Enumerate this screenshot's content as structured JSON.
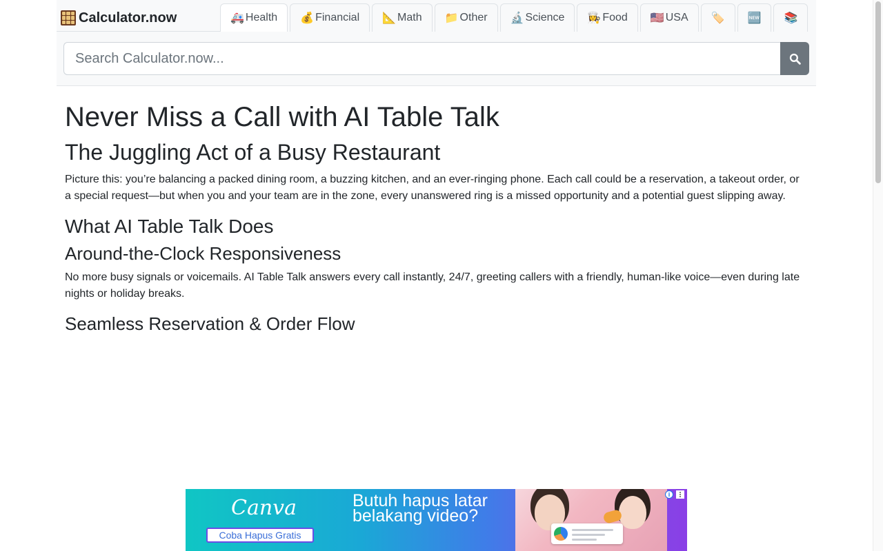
{
  "site": {
    "name": "Calculator.now"
  },
  "tabs": [
    {
      "emoji": "🚑",
      "label": "Health"
    },
    {
      "emoji": "💰",
      "label": "Financial"
    },
    {
      "emoji": "📐",
      "label": "Math"
    },
    {
      "emoji": "📁",
      "label": "Other"
    },
    {
      "emoji": "🔬",
      "label": "Science"
    },
    {
      "emoji": "👩‍🍳",
      "label": "Food"
    },
    {
      "emoji": "🇺🇸",
      "label": "USA"
    },
    {
      "emoji": "🏷️",
      "label": ""
    },
    {
      "emoji": "🆕",
      "label": ""
    },
    {
      "emoji": "📚",
      "label": ""
    }
  ],
  "search": {
    "placeholder": "Search Calculator.now...",
    "button_icon": "search-icon"
  },
  "article": {
    "h1": "Never Miss a Call with AI Table Talk",
    "h2_juggle": "The Juggling Act of a Busy Restaurant",
    "p_juggle": "Picture this: you’re balancing a packed dining room, a buzzing kitchen, and an ever-ringing phone. Each call could be a reservation, a takeout order, or a special request—but when you and your team are in the zone, every unanswered ring is a missed opportunity and a potential guest slipping away.",
    "h2_what": "What AI Table Talk Does",
    "h3_around": "Around-the-Clock Responsiveness",
    "p_around": "No more busy signals or voicemails. AI Table Talk answers every call instantly, 24/7, greeting callers with a friendly, human-like voice—even during late nights or holiday breaks.",
    "h3_seamless": "Seamless Reservation & Order Flow"
  },
  "ad": {
    "brand": "Canva",
    "cta": "Coba Hapus Gratis",
    "headline": "Butuh hapus latar belakang video?",
    "info_label": "i"
  }
}
